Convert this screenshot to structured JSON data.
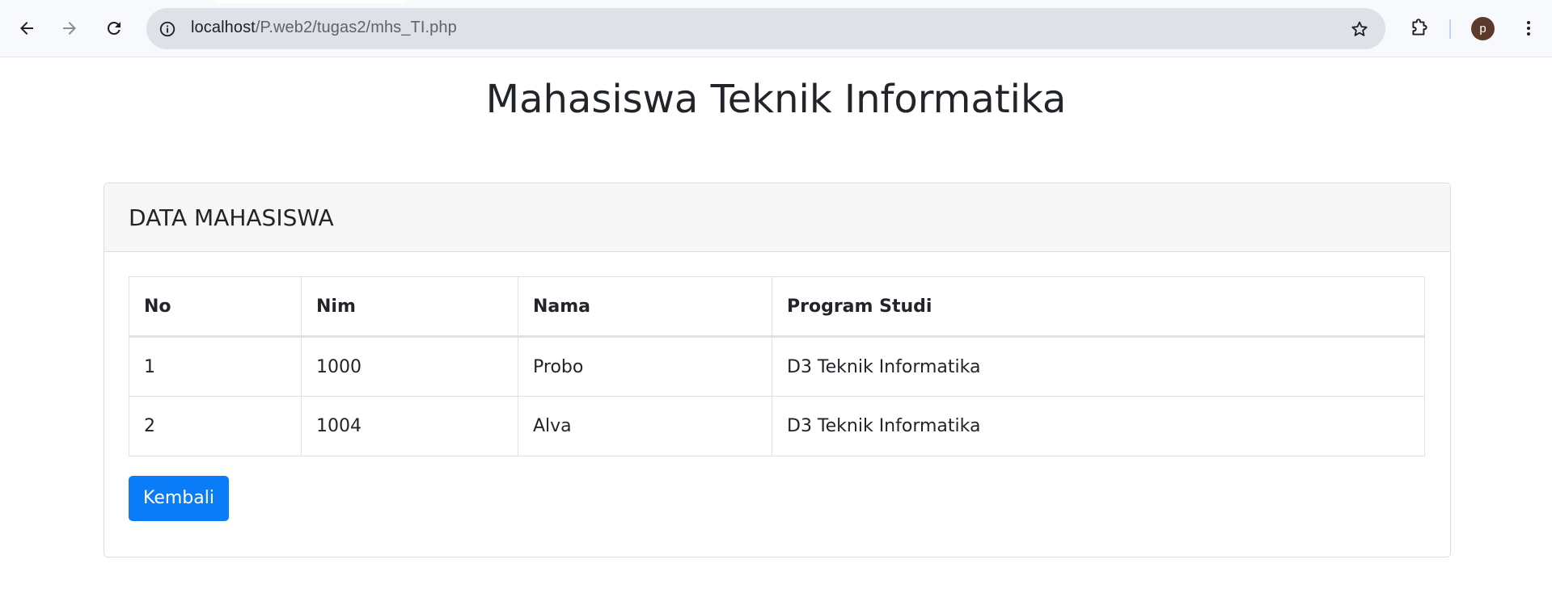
{
  "browser": {
    "url_host": "localhost",
    "url_path": "/P.web2/tugas2/mhs_TI.php",
    "profile_initial": "p"
  },
  "page": {
    "title": "Mahasiswa Teknik Informatika"
  },
  "card": {
    "header": "DATA MAHASISWA",
    "table": {
      "headers": [
        "No",
        "Nim",
        "Nama",
        "Program Studi"
      ],
      "rows": [
        [
          "1",
          "1000",
          "Probo",
          "D3 Teknik Informatika"
        ],
        [
          "2",
          "1004",
          "Alva",
          "D3 Teknik Informatika"
        ]
      ]
    },
    "back_button": "Kembali"
  },
  "colors": {
    "primary_button": "#0a7cf7",
    "card_header_bg": "#f7f7f7",
    "avatar_bg": "#5d3a2c"
  }
}
